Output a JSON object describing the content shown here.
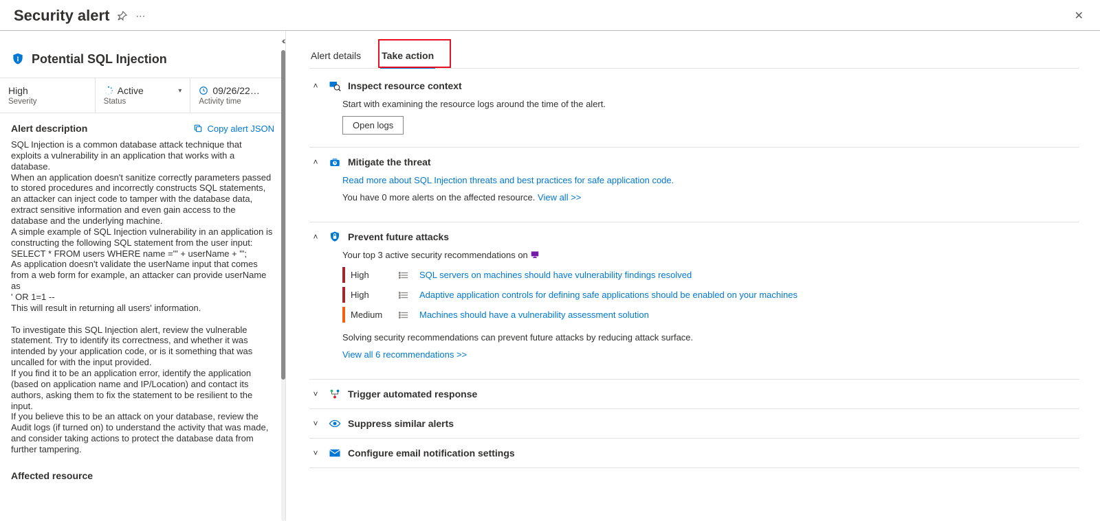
{
  "header": {
    "title": "Security alert"
  },
  "left": {
    "alert_name": "Potential SQL Injection",
    "severity_value": "High",
    "severity_label": "Severity",
    "status_value": "Active",
    "status_label": "Status",
    "time_value": "09/26/22…",
    "time_label": "Activity time",
    "desc_heading": "Alert description",
    "copy_json_label": "Copy alert JSON",
    "description_text": "SQL Injection is a common database attack technique that exploits a vulnerability in an application that works with a database.\nWhen an application doesn't sanitize correctly parameters passed to stored procedures and incorrectly constructs SQL statements, an attacker can inject code to tamper with the database data, extract sensitive information and even gain access to the database and the underlying machine.\nA simple example of SQL Injection vulnerability in an application is constructing the following SQL statement from the user input:\nSELECT * FROM users WHERE name ='\" + userName + \"';\nAs application doesn't validate the userName input that comes from a web form for example, an attacker can provide userName as\n' OR 1=1 --\nThis will result in returning all users' information.\n\nTo investigate this SQL Injection alert, review the vulnerable statement. Try to identify its correctness, and whether it was intended by your application code, or is it something that was uncalled for with the input provided.\nIf you find it to be an application error, identify the application (based on application name and IP/Location) and contact its authors, asking them to fix the statement to be resilient to the input.\nIf you believe this to be an attack on your database, review the Audit logs (if turned on) to understand the activity that was made, and consider taking actions to protect the database data from further tampering.",
    "affected_heading": "Affected resource"
  },
  "tabs": {
    "details": "Alert details",
    "action": "Take action"
  },
  "actions": {
    "inspect": {
      "title": "Inspect resource context",
      "body": "Start with examining the resource logs around the time of the alert.",
      "button": "Open logs"
    },
    "mitigate": {
      "title": "Mitigate the threat",
      "link": "Read more about SQL Injection threats and best practices for safe application code.",
      "body_prefix": "You have 0 more alerts on the affected resource. ",
      "viewall": "View all >>"
    },
    "prevent": {
      "title": "Prevent future attacks",
      "intro": "Your top 3 active security recommendations on ",
      "recs": [
        {
          "sev": "High",
          "cls": "rec-high",
          "text": "SQL servers on machines should have vulnerability findings resolved"
        },
        {
          "sev": "High",
          "cls": "rec-high",
          "text": "Adaptive application controls for defining safe applications should be enabled on your machines"
        },
        {
          "sev": "Medium",
          "cls": "rec-med",
          "text": "Machines should have a vulnerability assessment solution"
        }
      ],
      "footer": "Solving security recommendations can prevent future attacks by reducing attack surface.",
      "viewall": "View all 6 recommendations >>"
    },
    "trigger": {
      "title": "Trigger automated response"
    },
    "suppress": {
      "title": "Suppress similar alerts"
    },
    "email": {
      "title": "Configure email notification settings"
    }
  }
}
